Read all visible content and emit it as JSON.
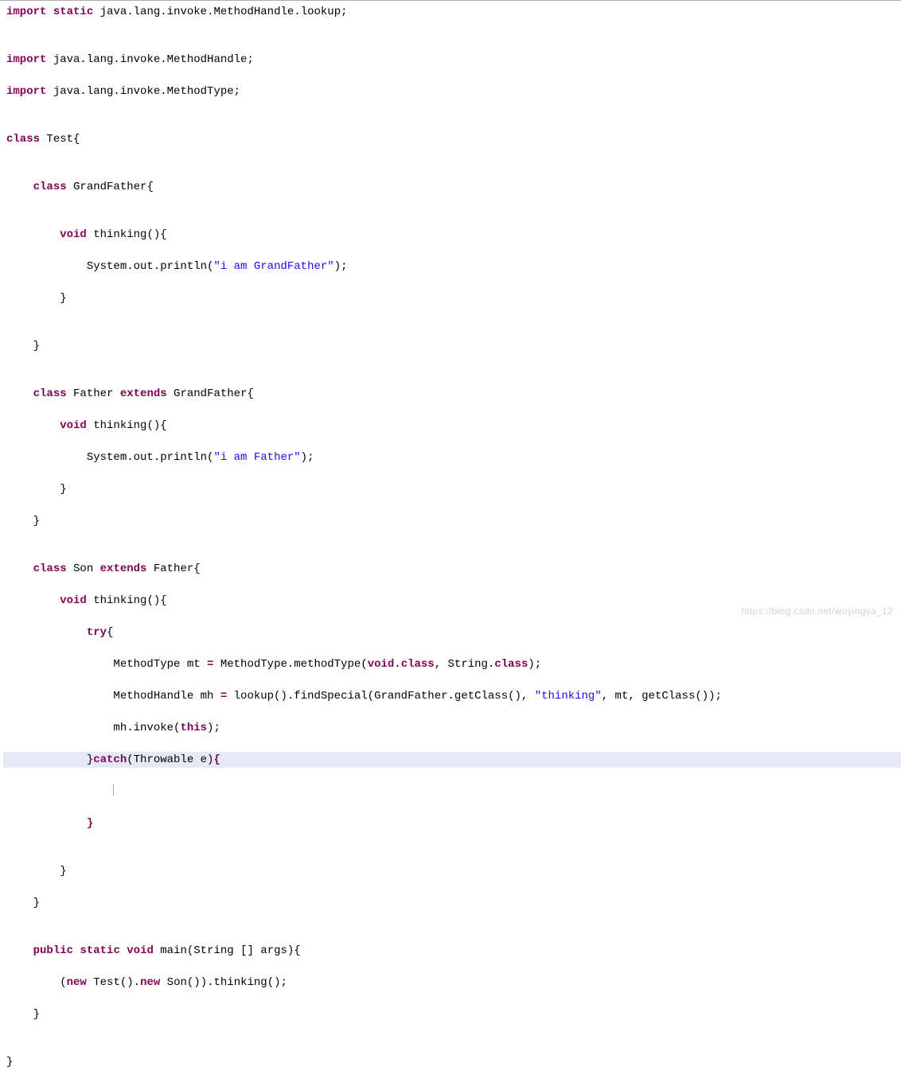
{
  "colors": {
    "keyword": "#7f0055",
    "string": "#2a00ff",
    "highlight_bg": "#e6e8f5"
  },
  "watermark": "https://blog.csdn.net/wuyingya_12",
  "code_lines": [
    {
      "hl": false,
      "tokens": [
        {
          "t": "import",
          "c": "kw"
        },
        {
          "t": " ",
          "c": "plain"
        },
        {
          "t": "static",
          "c": "kw"
        },
        {
          "t": " java.lang.invoke.MethodHandle.lookup;",
          "c": "plain"
        }
      ]
    },
    {
      "hl": false,
      "tokens": [
        {
          "t": "",
          "c": "plain"
        }
      ]
    },
    {
      "hl": false,
      "tokens": [
        {
          "t": "import",
          "c": "kw"
        },
        {
          "t": " java.lang.invoke.MethodHandle;",
          "c": "plain"
        }
      ]
    },
    {
      "hl": false,
      "tokens": [
        {
          "t": "import",
          "c": "kw"
        },
        {
          "t": " java.lang.invoke.MethodType;",
          "c": "plain"
        }
      ]
    },
    {
      "hl": false,
      "tokens": [
        {
          "t": "",
          "c": "plain"
        }
      ]
    },
    {
      "hl": false,
      "tokens": [
        {
          "t": "class",
          "c": "kw"
        },
        {
          "t": " Test{",
          "c": "plain"
        }
      ]
    },
    {
      "hl": false,
      "tokens": [
        {
          "t": "",
          "c": "plain"
        }
      ]
    },
    {
      "hl": false,
      "tokens": [
        {
          "t": "    ",
          "c": "plain"
        },
        {
          "t": "class",
          "c": "kw"
        },
        {
          "t": " GrandFather{",
          "c": "plain"
        }
      ]
    },
    {
      "hl": false,
      "tokens": [
        {
          "t": "",
          "c": "plain"
        }
      ]
    },
    {
      "hl": false,
      "tokens": [
        {
          "t": "        ",
          "c": "plain"
        },
        {
          "t": "void",
          "c": "kw"
        },
        {
          "t": " thinking(){",
          "c": "plain"
        }
      ]
    },
    {
      "hl": false,
      "tokens": [
        {
          "t": "            System.out.println(",
          "c": "plain"
        },
        {
          "t": "\"i am GrandFather\"",
          "c": "str"
        },
        {
          "t": ");",
          "c": "plain"
        }
      ]
    },
    {
      "hl": false,
      "tokens": [
        {
          "t": "        }",
          "c": "plain"
        }
      ]
    },
    {
      "hl": false,
      "tokens": [
        {
          "t": "",
          "c": "plain"
        }
      ]
    },
    {
      "hl": false,
      "tokens": [
        {
          "t": "    }",
          "c": "plain"
        }
      ]
    },
    {
      "hl": false,
      "tokens": [
        {
          "t": "",
          "c": "plain"
        }
      ]
    },
    {
      "hl": false,
      "tokens": [
        {
          "t": "    ",
          "c": "plain"
        },
        {
          "t": "class",
          "c": "kw"
        },
        {
          "t": " Father ",
          "c": "plain"
        },
        {
          "t": "extends",
          "c": "kw"
        },
        {
          "t": " GrandFather{",
          "c": "plain"
        }
      ]
    },
    {
      "hl": false,
      "tokens": [
        {
          "t": "        ",
          "c": "plain"
        },
        {
          "t": "void",
          "c": "kw"
        },
        {
          "t": " thinking(){",
          "c": "plain"
        }
      ]
    },
    {
      "hl": false,
      "tokens": [
        {
          "t": "            System.out.println(",
          "c": "plain"
        },
        {
          "t": "\"i am Father\"",
          "c": "str"
        },
        {
          "t": ");",
          "c": "plain"
        }
      ]
    },
    {
      "hl": false,
      "tokens": [
        {
          "t": "        }",
          "c": "plain"
        }
      ]
    },
    {
      "hl": false,
      "tokens": [
        {
          "t": "    }",
          "c": "plain"
        }
      ]
    },
    {
      "hl": false,
      "tokens": [
        {
          "t": "",
          "c": "plain"
        }
      ]
    },
    {
      "hl": false,
      "tokens": [
        {
          "t": "    ",
          "c": "plain"
        },
        {
          "t": "class",
          "c": "kw"
        },
        {
          "t": " Son ",
          "c": "plain"
        },
        {
          "t": "extends",
          "c": "kw"
        },
        {
          "t": " Father{",
          "c": "plain"
        }
      ]
    },
    {
      "hl": false,
      "tokens": [
        {
          "t": "        ",
          "c": "plain"
        },
        {
          "t": "void",
          "c": "kw"
        },
        {
          "t": " thinking(){",
          "c": "plain"
        }
      ]
    },
    {
      "hl": false,
      "tokens": [
        {
          "t": "            ",
          "c": "plain"
        },
        {
          "t": "try",
          "c": "kw"
        },
        {
          "t": "{",
          "c": "plain"
        }
      ]
    },
    {
      "hl": false,
      "tokens": [
        {
          "t": "                MethodType mt ",
          "c": "plain"
        },
        {
          "t": "=",
          "c": "kw"
        },
        {
          "t": " MethodType.methodType(",
          "c": "plain"
        },
        {
          "t": "void",
          "c": "kw"
        },
        {
          "t": ".",
          "c": "plain"
        },
        {
          "t": "class",
          "c": "kw"
        },
        {
          "t": ", String.",
          "c": "plain"
        },
        {
          "t": "class",
          "c": "kw"
        },
        {
          "t": ");",
          "c": "plain"
        }
      ]
    },
    {
      "hl": false,
      "tokens": [
        {
          "t": "                MethodHandle mh ",
          "c": "plain"
        },
        {
          "t": "=",
          "c": "kw"
        },
        {
          "t": " lookup().findSpecial(GrandFather.getClass(), ",
          "c": "plain"
        },
        {
          "t": "\"thinking\"",
          "c": "str"
        },
        {
          "t": ", mt, getClass());",
          "c": "plain"
        }
      ]
    },
    {
      "hl": false,
      "tokens": [
        {
          "t": "                mh.invoke(",
          "c": "plain"
        },
        {
          "t": "this",
          "c": "kw"
        },
        {
          "t": ");",
          "c": "plain"
        }
      ]
    },
    {
      "hl": true,
      "tokens": [
        {
          "t": "            }",
          "c": "plain"
        },
        {
          "t": "catch",
          "c": "kw"
        },
        {
          "t": "(Throwable e)",
          "c": "plain"
        },
        {
          "t": "{",
          "c": "kw"
        }
      ]
    },
    {
      "hl": false,
      "tokens": [
        {
          "t": "                ",
          "c": "plain"
        }
      ],
      "caret": true
    },
    {
      "hl": false,
      "tokens": [
        {
          "t": "            ",
          "c": "plain"
        },
        {
          "t": "}",
          "c": "kw"
        }
      ]
    },
    {
      "hl": false,
      "tokens": [
        {
          "t": "",
          "c": "plain"
        }
      ]
    },
    {
      "hl": false,
      "tokens": [
        {
          "t": "        }",
          "c": "plain"
        }
      ]
    },
    {
      "hl": false,
      "tokens": [
        {
          "t": "    }",
          "c": "plain"
        }
      ]
    },
    {
      "hl": false,
      "tokens": [
        {
          "t": "",
          "c": "plain"
        }
      ]
    },
    {
      "hl": false,
      "tokens": [
        {
          "t": "    ",
          "c": "plain"
        },
        {
          "t": "public",
          "c": "kw"
        },
        {
          "t": " ",
          "c": "plain"
        },
        {
          "t": "static",
          "c": "kw"
        },
        {
          "t": " ",
          "c": "plain"
        },
        {
          "t": "void",
          "c": "kw"
        },
        {
          "t": " main(String [] args){",
          "c": "plain"
        }
      ]
    },
    {
      "hl": false,
      "tokens": [
        {
          "t": "        (",
          "c": "plain"
        },
        {
          "t": "new",
          "c": "kw"
        },
        {
          "t": " Test().",
          "c": "plain"
        },
        {
          "t": "new",
          "c": "kw"
        },
        {
          "t": " Son()).thinking();",
          "c": "plain"
        }
      ]
    },
    {
      "hl": false,
      "tokens": [
        {
          "t": "    }",
          "c": "plain"
        }
      ]
    },
    {
      "hl": false,
      "tokens": [
        {
          "t": "",
          "c": "plain"
        }
      ]
    },
    {
      "hl": false,
      "tokens": [
        {
          "t": "}",
          "c": "plain"
        }
      ]
    }
  ]
}
